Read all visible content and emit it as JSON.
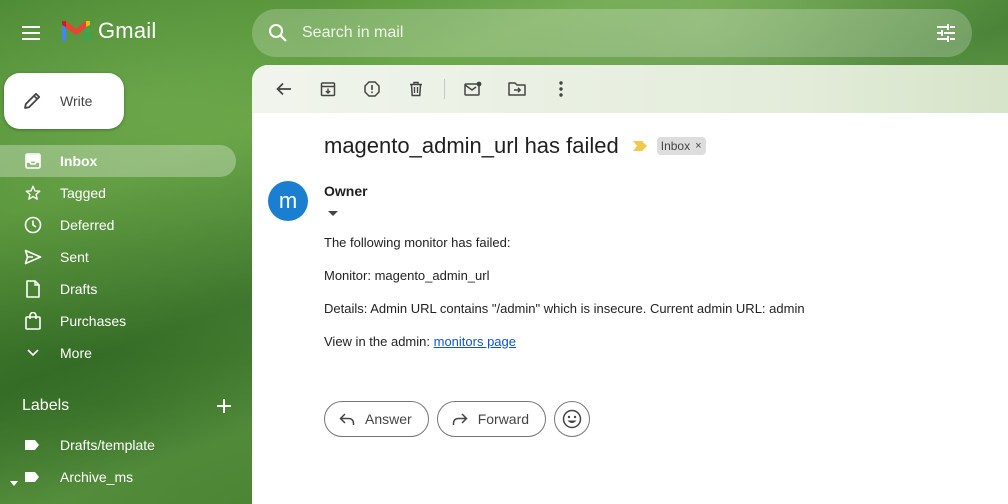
{
  "app": {
    "name": "Gmail"
  },
  "search": {
    "placeholder": "Search in mail"
  },
  "compose": {
    "label": "Write"
  },
  "nav": [
    {
      "label": "Inbox",
      "icon": "inbox-icon",
      "active": true
    },
    {
      "label": "Tagged",
      "icon": "star-icon"
    },
    {
      "label": "Deferred",
      "icon": "clock-icon"
    },
    {
      "label": "Sent",
      "icon": "send-icon"
    },
    {
      "label": "Drafts",
      "icon": "draft-icon"
    },
    {
      "label": "Purchases",
      "icon": "shopping-bag-icon"
    },
    {
      "label": "More",
      "icon": "chevron-down-icon"
    }
  ],
  "labels": {
    "heading": "Labels",
    "items": [
      {
        "label": "Drafts/template",
        "icon": "label-icon"
      },
      {
        "label": "Archive_ms",
        "icon": "label-icon"
      }
    ]
  },
  "email": {
    "subject": "magento_admin_url has failed",
    "chip": "Inbox",
    "chip_close": "×",
    "avatar_letter": "m",
    "sender": "Owner",
    "body": {
      "line1": "The following monitor has failed:",
      "line2": "Monitor: magento_admin_url",
      "line3": "Details: Admin URL contains \"/admin\" which is insecure. Current admin URL: admin",
      "line4_prefix": "View in the admin: ",
      "line4_link": "monitors page"
    },
    "actions": {
      "reply": "Answer",
      "forward": "Forward"
    }
  },
  "colors": {
    "accent_avatar": "#1b7fd1",
    "link": "#1155cc",
    "importance": "#f2c94c"
  }
}
